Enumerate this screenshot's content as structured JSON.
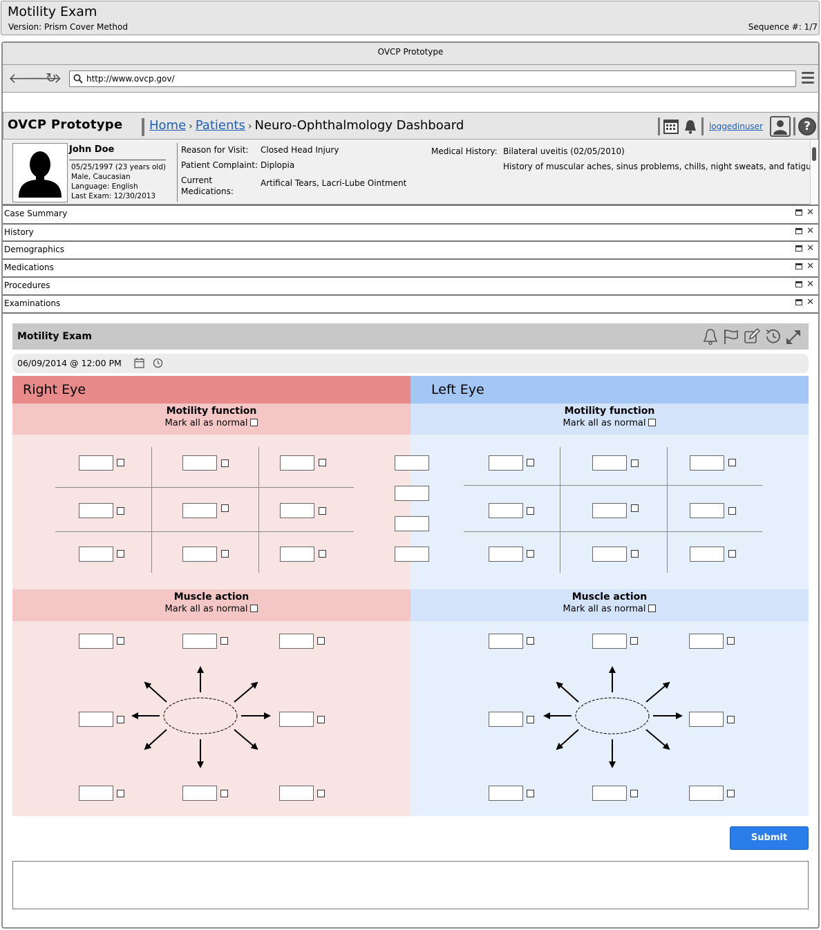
{
  "doc": {
    "title": "Motility Exam",
    "version": "Version: Prism Cover Method",
    "sequence": "Sequence #:  1/7"
  },
  "browser": {
    "window_title": "OVCP Prototype",
    "url": "http://www.ovcp.gov/",
    "icons": [
      "back-arrow-icon",
      "forward-arrow-icon",
      "reload-icon",
      "search-icon",
      "hamburger-menu-icon"
    ]
  },
  "app": {
    "name": "OVCP Prototype",
    "breadcrumb": {
      "home": "Home",
      "patients": "Patients",
      "current": "Neuro-Ophthalmology Dashboard"
    },
    "user": "loggedinuser"
  },
  "patient": {
    "name": "John Doe",
    "dob": "05/25/1997 (23 years old)",
    "sex_race": "Male, Caucasian",
    "language": "Language: English",
    "last_exam": "Last Exam: 12/30/2013",
    "reason_label": "Reason for Visit:",
    "reason": "Closed Head Injury",
    "complaint_label": "Patient Complaint:",
    "complaint": "Diplopia",
    "meds_label_1": "Current",
    "meds_label_2": "Medications:",
    "meds": "Artifical Tears, Lacri-Lube Ointment",
    "history_label": "Medical History:",
    "history_1": "Bilateral uveitis (02/05/2010)",
    "history_2": "History of muscular aches, sinus problems, chills, night sweats, and fatigue"
  },
  "accordion": [
    "Case Summary",
    "History",
    "Demographics",
    "Medications",
    "Procedures",
    "Examinations"
  ],
  "exam": {
    "title": "Motility Exam",
    "datetime": "06/09/2014 @ 12:00 PM",
    "right_eye": "Right Eye",
    "left_eye": "Left Eye",
    "motility_title": "Motility function",
    "muscle_title": "Muscle action",
    "mark_normal": "Mark all as normal",
    "submit": "Submit"
  },
  "colors": {
    "right_header": "#e88a8a",
    "right_sub": "#f4c6c6",
    "right_body": "#f9e4e4",
    "left_header": "#a4c6f4",
    "left_sub": "#d2e3fa",
    "left_body": "#e6f0fc",
    "submit": "#2b7de9",
    "link": "#1f5fb4"
  }
}
